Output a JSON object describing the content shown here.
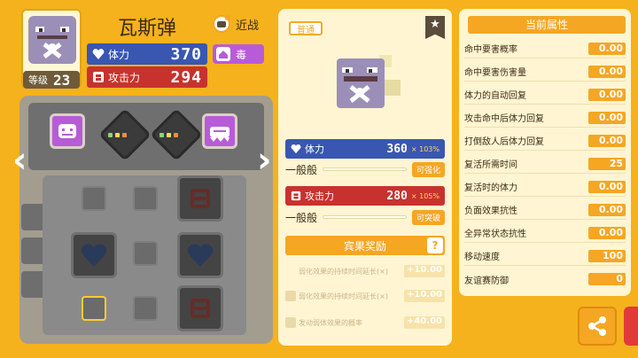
{
  "pokemon": {
    "name": "瓦斯弹",
    "level_label": "等级",
    "level": "23",
    "range": "近战",
    "type": "毒",
    "hp_label": "体力",
    "hp": "370",
    "atk_label": "攻击力",
    "atk": "294"
  },
  "detail": {
    "rarity": "普通",
    "hp_label": "体力",
    "hp": "360",
    "hp_pct": "× 103%",
    "hp_sub": "一般般",
    "hp_btn": "可强化",
    "atk_label": "攻击力",
    "atk": "280",
    "atk_pct": "× 105%",
    "atk_sub": "一般般",
    "atk_btn": "可突破",
    "reward_title": "宾果奖励",
    "reward_help": "?",
    "rewards": [
      {
        "label": "弱化效果的持续时间延长(×)",
        "value": "+10.00"
      },
      {
        "label": "弱化效果的持续时间延长(×)",
        "value": "+10.00"
      },
      {
        "label": "发动弱体效果的概率",
        "value": "+40.00"
      }
    ]
  },
  "attributes": {
    "title": "当前属性",
    "rows": [
      {
        "label": "命中要害概率",
        "value": "0.00"
      },
      {
        "label": "命中要害伤害量",
        "value": "0.00"
      },
      {
        "label": "体力的自动回复",
        "value": "0.00"
      },
      {
        "label": "攻击命中后体力回复",
        "value": "0.00"
      },
      {
        "label": "打倒敌人后体力回复",
        "value": "0.00"
      },
      {
        "label": "复活所需时间",
        "value": "25"
      },
      {
        "label": "复活时的体力",
        "value": "0.00"
      },
      {
        "label": "负面效果抗性",
        "value": "0.00"
      },
      {
        "label": "全异常状态抗性",
        "value": "0.00"
      },
      {
        "label": "移动速度",
        "value": "100"
      },
      {
        "label": "友谊赛防御",
        "value": "0"
      }
    ]
  },
  "colors": {
    "bg": "#f5b21c",
    "hp": "#3957b0",
    "atk": "#c8322e",
    "accent": "#f5a623",
    "poison": "#b85bd9"
  },
  "icons": [
    "heart-icon",
    "attack-icon",
    "star-icon",
    "share-icon",
    "left-arrow-icon",
    "right-arrow-icon",
    "question-icon"
  ]
}
